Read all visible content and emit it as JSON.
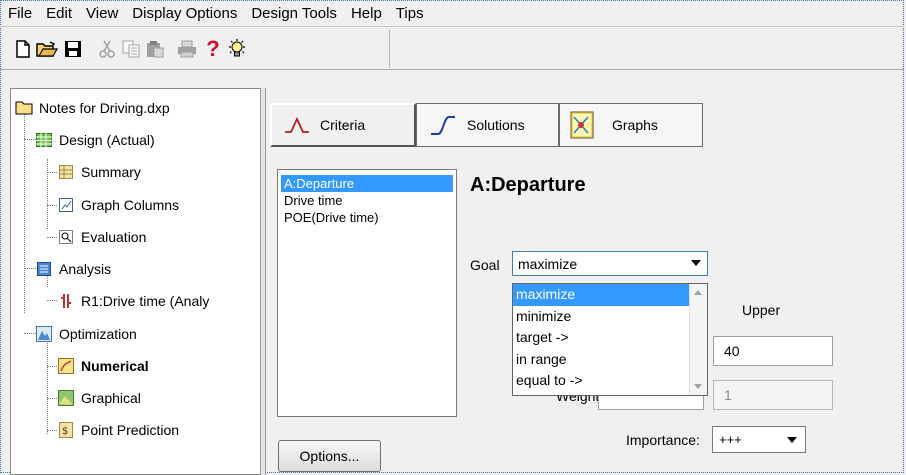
{
  "menu": {
    "items": [
      "File",
      "Edit",
      "View",
      "Display Options",
      "Design Tools",
      "Help",
      "Tips"
    ]
  },
  "toolbar": {
    "icons": [
      "new-file-icon",
      "open-folder-icon",
      "save-icon",
      "cut-icon",
      "copy-icon",
      "paste-icon",
      "print-icon",
      "help-icon",
      "tips-lightbulb-icon"
    ],
    "help_glyph": "?"
  },
  "tree": {
    "root": "Notes for Driving.dxp",
    "design": "Design (Actual)",
    "summary": "Summary",
    "graph_columns": "Graph Columns",
    "evaluation": "Evaluation",
    "analysis": "Analysis",
    "r1": "R1:Drive time (Analy",
    "optimization": "Optimization",
    "numerical": "Numerical",
    "graphical": "Graphical",
    "point_prediction": "Point Prediction"
  },
  "tabs": {
    "criteria": "Criteria",
    "solutions": "Solutions",
    "graphs": "Graphs"
  },
  "criteria_list": [
    "A:Departure",
    "Drive time",
    "POE(Drive time)"
  ],
  "criteria_selected_index": 0,
  "selected_heading": "A:Departure",
  "goal": {
    "label": "Goal",
    "value": "maximize",
    "options": [
      "maximize",
      "minimize",
      "target ->",
      "in range",
      "equal to ->"
    ]
  },
  "limits": {
    "upper_label": "Upper",
    "upper_value": "40"
  },
  "weights": {
    "label": "Weights:",
    "upper_weight": "1"
  },
  "importance": {
    "label": "Importance:",
    "value": "+++"
  },
  "options_button": "Options...",
  "colors": {
    "selection": "#3399ff",
    "background": "#f0f0f0"
  }
}
